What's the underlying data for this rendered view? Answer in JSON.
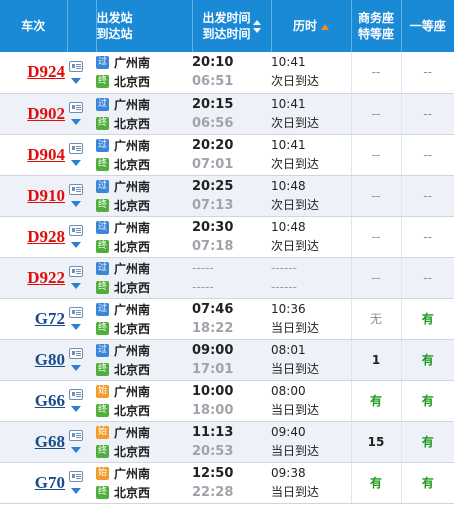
{
  "header": {
    "train": "车次",
    "station_from": "出发站",
    "station_to": "到达站",
    "time_dep": "出发时间",
    "time_arr": "到达时间",
    "duration": "历时",
    "biz_line1": "商务座",
    "biz_line2": "特等座",
    "first": "一等座"
  },
  "badges": {
    "pass": "过",
    "start": "始",
    "end": "终"
  },
  "colors": {
    "header_bg": "#1a8ad7",
    "train_red": "#e00d0d",
    "train_blue": "#1a4c8c",
    "seat_green": "#1f9a1f",
    "sort_active": "#f48b1e"
  },
  "icons": [
    "info-icon",
    "chevron-down-icon",
    "sort-up-icon",
    "sort-down-icon"
  ],
  "rows": [
    {
      "train": "D924",
      "from": "广州南",
      "to": "北京西",
      "dep": "20:10",
      "arr": "06:51",
      "dur": "10:41",
      "dur_note": "次日到达",
      "biz": "--",
      "first": "--"
    },
    {
      "train": "D902",
      "from": "广州南",
      "to": "北京西",
      "dep": "20:15",
      "arr": "06:56",
      "dur": "10:41",
      "dur_note": "次日到达",
      "biz": "--",
      "first": "--"
    },
    {
      "train": "D904",
      "from": "广州南",
      "to": "北京西",
      "dep": "20:20",
      "arr": "07:01",
      "dur": "10:41",
      "dur_note": "次日到达",
      "biz": "--",
      "first": "--"
    },
    {
      "train": "D910",
      "from": "广州南",
      "to": "北京西",
      "dep": "20:25",
      "arr": "07:13",
      "dur": "10:48",
      "dur_note": "次日到达",
      "biz": "--",
      "first": "--"
    },
    {
      "train": "D928",
      "from": "广州南",
      "to": "北京西",
      "dep": "20:30",
      "arr": "07:18",
      "dur": "10:48",
      "dur_note": "次日到达",
      "biz": "--",
      "first": "--"
    },
    {
      "train": "D922",
      "from": "广州南",
      "to": "北京西",
      "dep": "-----",
      "arr": "-----",
      "dur": "------",
      "dur_note": "------",
      "biz": "--",
      "first": "--"
    },
    {
      "train": "G72",
      "from": "广州南",
      "to": "北京西",
      "dep": "07:46",
      "arr": "18:22",
      "dur": "10:36",
      "dur_note": "当日到达",
      "biz": "无",
      "first": "有"
    },
    {
      "train": "G80",
      "from": "广州南",
      "to": "北京西",
      "dep": "09:00",
      "arr": "17:01",
      "dur": "08:01",
      "dur_note": "当日到达",
      "biz": "1",
      "first": "有"
    },
    {
      "train": "G66",
      "from": "广州南",
      "to": "北京西",
      "dep": "10:00",
      "arr": "18:00",
      "dur": "08:00",
      "dur_note": "当日到达",
      "biz": "有",
      "first": "有"
    },
    {
      "train": "G68",
      "from": "广州南",
      "to": "北京西",
      "dep": "11:13",
      "arr": "20:53",
      "dur": "09:40",
      "dur_note": "当日到达",
      "biz": "15",
      "first": "有"
    },
    {
      "train": "G70",
      "from": "广州南",
      "to": "北京西",
      "dep": "12:50",
      "arr": "22:28",
      "dur": "09:38",
      "dur_note": "当日到达",
      "biz": "有",
      "first": "有"
    }
  ]
}
